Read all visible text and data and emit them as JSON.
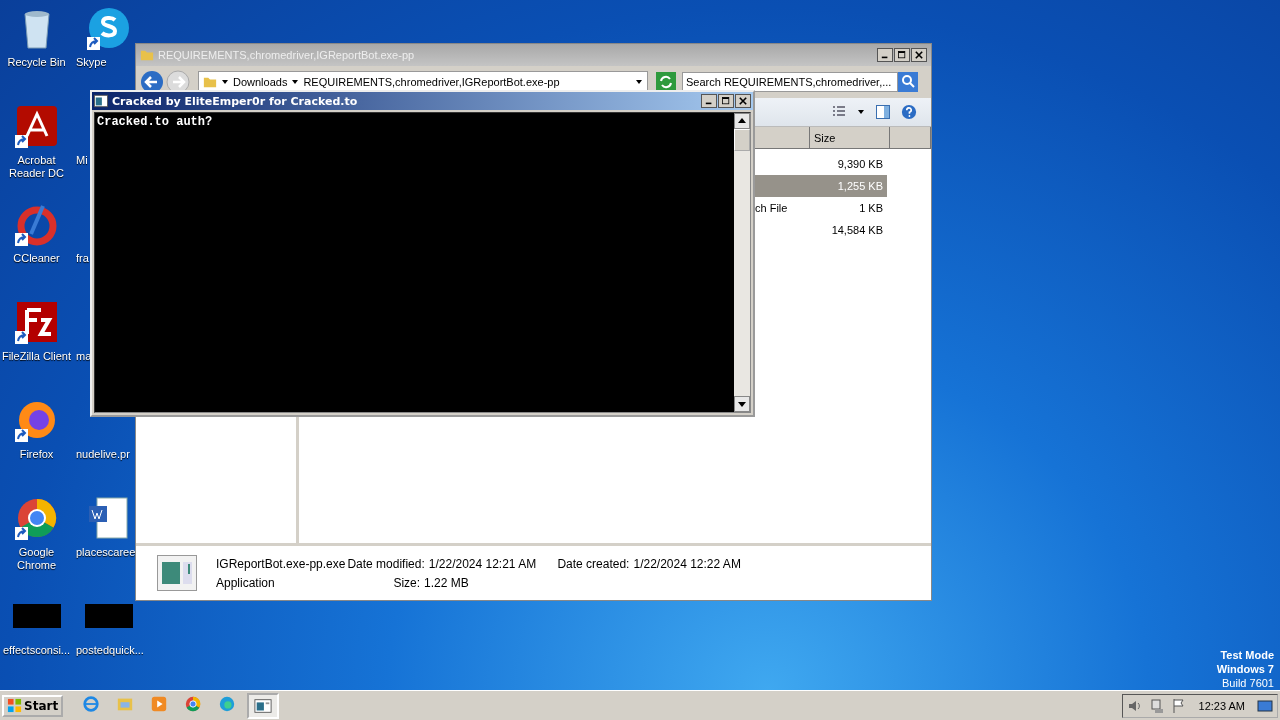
{
  "desktop": {
    "icons": [
      {
        "label": "Recycle Bin",
        "kind": "recycle-bin",
        "shortcut": false
      },
      {
        "label": "Acrobat Reader DC",
        "kind": "acrobat",
        "shortcut": true
      },
      {
        "label": "CCleaner",
        "kind": "ccleaner",
        "shortcut": true
      },
      {
        "label": "FileZilla Client",
        "kind": "filezilla",
        "shortcut": true
      },
      {
        "label": "Firefox",
        "kind": "firefox",
        "shortcut": true
      },
      {
        "label": "Google Chrome",
        "kind": "chrome",
        "shortcut": true
      },
      {
        "label": "effectsconsi...",
        "kind": "black",
        "shortcut": false
      },
      {
        "label": "Skype",
        "kind": "skype",
        "shortcut": true
      },
      {
        "label": "Mi",
        "kind": "hidden"
      },
      {
        "label": "fra",
        "kind": "hidden"
      },
      {
        "label": "ma",
        "kind": "hidden"
      },
      {
        "label": "nudelive.pr",
        "kind": "hidden"
      },
      {
        "label": "placescaree",
        "kind": "word",
        "shortcut": false
      },
      {
        "label": "postedquick...",
        "kind": "black",
        "shortcut": false
      }
    ],
    "watermark": [
      "Test Mode",
      "Windows 7",
      "Build 7601"
    ]
  },
  "explorer": {
    "title": "REQUIREMENTS,chromedriver,IGReportBot.exe-pp",
    "breadcrumbs": [
      "Downloads",
      "REQUIREMENTS,chromedriver,IGReportBot.exe-pp"
    ],
    "search": {
      "placeholder": "Search REQUIREMENTS,chromedriver,..."
    },
    "columns": [
      "Size"
    ],
    "rows": [
      {
        "size": "9,390 KB",
        "selected": false
      },
      {
        "size": "1,255 KB",
        "selected": true
      },
      {
        "type": "ch File",
        "size": "1 KB",
        "selected": false
      },
      {
        "size": "14,584 KB",
        "selected": false
      }
    ],
    "details": {
      "name": "IGReportBot.exe-pp.exe",
      "type": "Application",
      "fields": [
        {
          "label": "Date modified:",
          "value": "1/22/2024 12:21 AM"
        },
        {
          "label": "Size:",
          "value": "1.22 MB"
        },
        {
          "label": "Date created:",
          "value": "1/22/2024 12:22 AM"
        }
      ]
    }
  },
  "console": {
    "title": "Cracked by EliteEmper0r for Cracked.to",
    "lines": [
      "Cracked.to auth?"
    ]
  },
  "taskbar": {
    "start": "Start",
    "apps": [
      {
        "kind": "ie",
        "selected": false
      },
      {
        "kind": "explorer",
        "selected": false
      },
      {
        "kind": "media",
        "selected": false
      },
      {
        "kind": "chrome",
        "selected": false
      },
      {
        "kind": "edge",
        "selected": false
      },
      {
        "kind": "console",
        "selected": true
      }
    ],
    "clock": "12:23 AM"
  }
}
